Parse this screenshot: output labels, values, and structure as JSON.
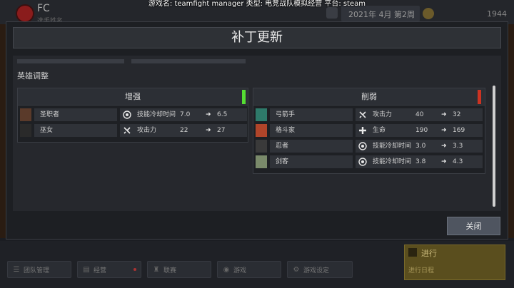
{
  "overlay": {
    "text": "游戏名: teamfight manager  类型: 电竞战队模拟经营  平台: steam"
  },
  "header": {
    "team_name": "FC",
    "team_sub": "选手姓名",
    "date": "2021年 4月 第2周",
    "money": "1944"
  },
  "nav": [
    {
      "label": "团队管理",
      "icon": "team-icon"
    },
    {
      "label": "经营",
      "icon": "ledger-icon"
    },
    {
      "label": "联赛",
      "icon": "trophy-icon"
    },
    {
      "label": "游戏",
      "icon": "gamepad-icon"
    },
    {
      "label": "游戏设定",
      "icon": "gear-icon"
    }
  ],
  "proceed": {
    "label": "进行",
    "sub": "进行日程"
  },
  "modal": {
    "title": "补丁更新",
    "section_label": "英雄调整",
    "close_label": "关闭",
    "buff": {
      "title": "增强",
      "accent": "#55dd33",
      "rows": [
        {
          "hero": "圣职者",
          "stat_icon": "target-icon",
          "stat": "技能冷却时间",
          "old": "7.0",
          "new": "6.5"
        },
        {
          "hero": "巫女",
          "stat_icon": "swords-icon",
          "stat": "攻击力",
          "old": "22",
          "new": "27"
        }
      ]
    },
    "nerf": {
      "title": "削弱",
      "accent": "#cc3322",
      "rows": [
        {
          "hero": "弓箭手",
          "stat_icon": "swords-icon",
          "stat": "攻击力",
          "old": "40",
          "new": "32"
        },
        {
          "hero": "格斗家",
          "stat_icon": "plus-icon",
          "stat": "生命",
          "old": "190",
          "new": "169"
        },
        {
          "hero": "忍者",
          "stat_icon": "target-icon",
          "stat": "技能冷却时间",
          "old": "3.0",
          "new": "3.3"
        },
        {
          "hero": "剑客",
          "stat_icon": "target-icon",
          "stat": "技能冷却时间",
          "old": "3.8",
          "new": "4.3"
        }
      ]
    },
    "arrow": "➜"
  }
}
